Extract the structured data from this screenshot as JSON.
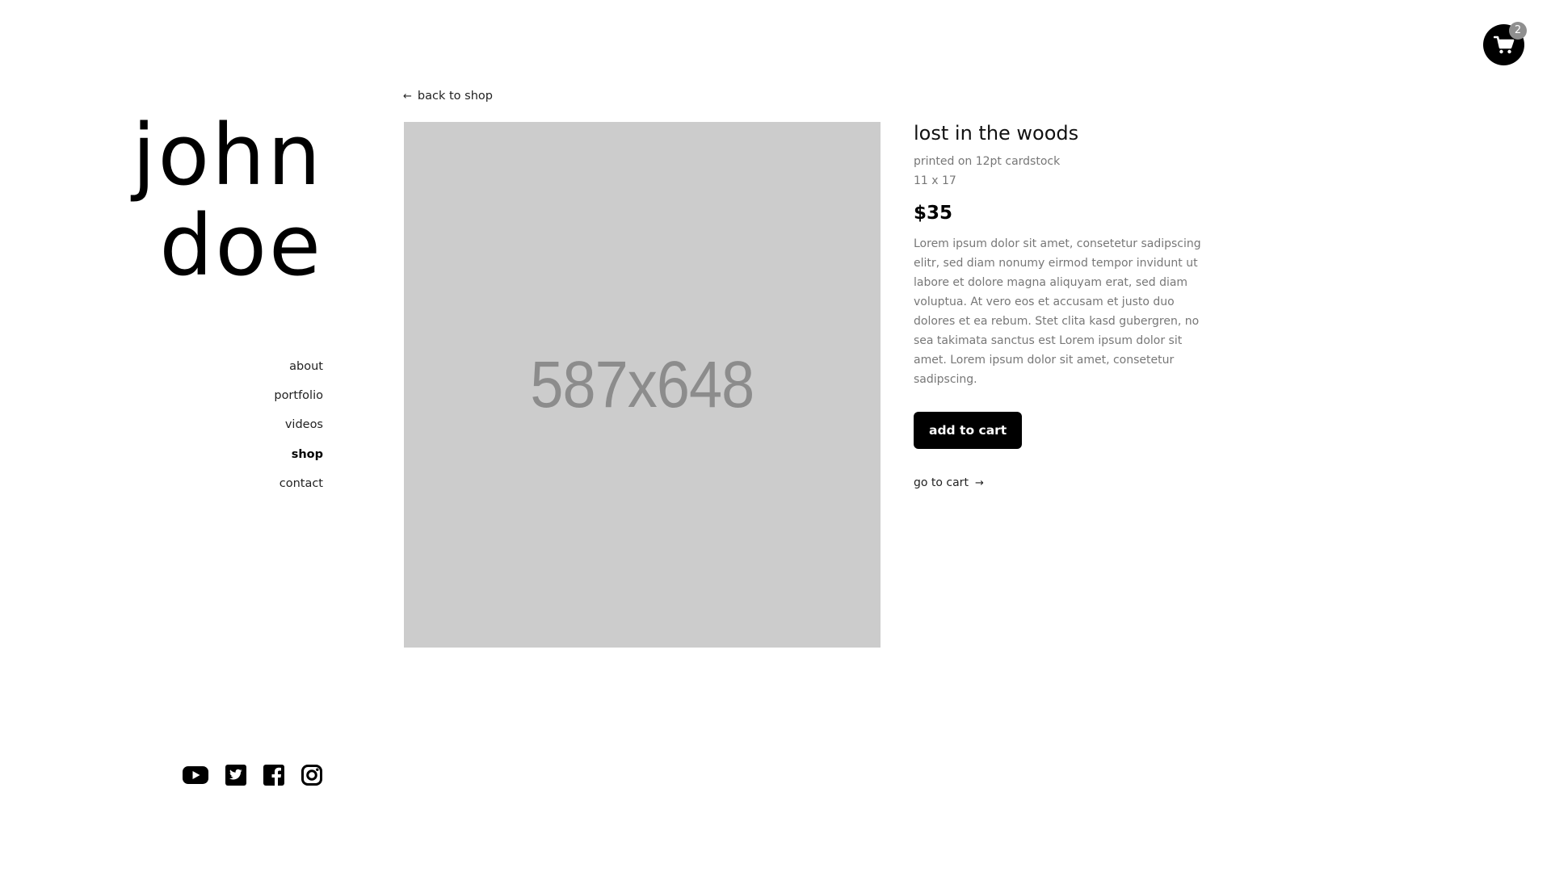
{
  "cart": {
    "count": "2",
    "icon": "shopping-cart-icon"
  },
  "logo": {
    "line1": "john",
    "line2": "doe"
  },
  "nav": {
    "items": [
      {
        "label": "about",
        "active": false
      },
      {
        "label": "portfolio",
        "active": false
      },
      {
        "label": "videos",
        "active": false
      },
      {
        "label": "shop",
        "active": true
      },
      {
        "label": "contact",
        "active": false
      }
    ]
  },
  "social": {
    "icons": [
      "youtube-icon",
      "twitter-icon",
      "facebook-icon",
      "instagram-icon"
    ]
  },
  "back_link": {
    "label": "back to shop",
    "icon": "arrow-left-icon"
  },
  "product": {
    "image_placeholder": "587x648",
    "title": "lost in the woods",
    "meta1": "printed on 12pt cardstock",
    "meta2": "11 x 17",
    "price": "$35",
    "description": "Lorem ipsum dolor sit amet, consetetur sadipscing elitr, sed diam nonumy eirmod tempor invidunt ut labore et dolore magna aliquyam erat, sed diam voluptua. At vero eos et accusam et justo duo dolores et ea rebum. Stet clita kasd gubergren, no sea takimata sanctus est Lorem ipsum dolor sit amet. Lorem ipsum dolor sit amet, consetetur sadipscing.",
    "add_to_cart_label": "add to cart",
    "go_to_cart_label": "go to cart"
  },
  "colors": {
    "accent": "#000000",
    "image_bg": "#cccccc",
    "muted_text": "#777777",
    "badge": "#8f8f8f"
  }
}
